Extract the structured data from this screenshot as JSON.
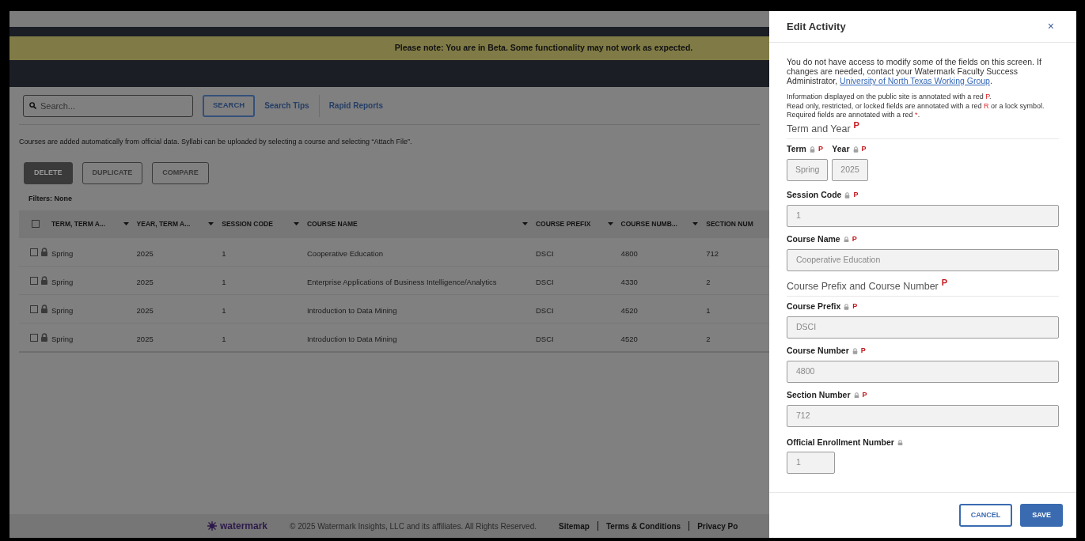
{
  "banner": "Please note: You are in Beta. Some functionality may not work as expected.",
  "search": {
    "placeholder": "Search...",
    "button": "SEARCH",
    "links": [
      "Search Tips",
      "Rapid Reports"
    ]
  },
  "notice": "Courses are added automatically from official data. Syllabi can be uploaded by selecting a course and selecting “Attach File”.",
  "actions": [
    {
      "label": "DELETE",
      "kind": "primary"
    },
    {
      "label": "DUPLICATE",
      "kind": "outline"
    },
    {
      "label": "COMPARE",
      "kind": "outline"
    }
  ],
  "filters": "Filters: None",
  "table": {
    "header_checked": false,
    "columns": [
      {
        "label": "TERM, TERM A...",
        "sortable": true
      },
      {
        "label": "YEAR, TERM A...",
        "sortable": true
      },
      {
        "label": "SESSION CODE",
        "sortable": true
      },
      {
        "label": "COURSE NAME",
        "sortable": true
      },
      {
        "label": "COURSE PREFIX",
        "sortable": true
      },
      {
        "label": "COURSE NUMB...",
        "sortable": true
      },
      {
        "label": "SECTION NUM",
        "sortable": false
      }
    ],
    "rows": [
      {
        "checked": false,
        "locked": true,
        "cells": [
          "Spring",
          "2025",
          "1",
          "Cooperative Education",
          "DSCI",
          "4800",
          "712"
        ]
      },
      {
        "checked": false,
        "locked": true,
        "cells": [
          "Spring",
          "2025",
          "1",
          "Enterprise Applications of Business Intelligence/Analytics",
          "DSCI",
          "4330",
          "2"
        ]
      },
      {
        "checked": false,
        "locked": true,
        "cells": [
          "Spring",
          "2025",
          "1",
          "Introduction to Data Mining",
          "DSCI",
          "4520",
          "1"
        ]
      },
      {
        "checked": false,
        "locked": true,
        "cells": [
          "Spring",
          "2025",
          "1",
          "Introduction to Data Mining",
          "DSCI",
          "4520",
          "2"
        ]
      }
    ]
  },
  "footer": {
    "logo": "watermark",
    "copyright": "© 2025 Watermark Insights, LLC and its affiliates. All Rights Reserved.",
    "links": [
      "Sitemap",
      "Terms & Conditions",
      "Privacy Po"
    ]
  },
  "drawer": {
    "title": "Edit Activity",
    "close": "×",
    "intro": {
      "text": "You do not have access to modify some of the fields on this screen. If changes are needed, contact your Watermark Faculty Success Administrator, ",
      "link": "University of North Texas Working Group",
      "end": "."
    },
    "notes": [
      {
        "text": "Information displayed on the public site is annotated with a red ",
        "mark": "P",
        "end": "."
      },
      {
        "text": "Read only, restricted, or locked fields are annotated with a red ",
        "mark": "R",
        "end": " or a lock symbol."
      },
      {
        "text": "Required fields are annotated with a red ",
        "mark": "*",
        "end": "."
      }
    ],
    "sections": [
      {
        "kind": "heading",
        "label": "Term and Year",
        "mark": "P"
      },
      {
        "kind": "pair",
        "fields": [
          {
            "label": "Term",
            "locked": true,
            "mark": "P",
            "value": "Spring"
          },
          {
            "label": "Year",
            "locked": true,
            "mark": "P",
            "value": "2025"
          }
        ]
      },
      {
        "kind": "field",
        "label": "Session Code",
        "locked": true,
        "mark": "P",
        "value": "1"
      },
      {
        "kind": "field",
        "label": "Course Name",
        "locked": true,
        "mark": "P",
        "value": "Cooperative Education"
      },
      {
        "kind": "heading",
        "label": "Course Prefix and Course Number",
        "mark": "P"
      },
      {
        "kind": "field",
        "label": "Course Prefix",
        "locked": true,
        "mark": "P",
        "value": "DSCI"
      },
      {
        "kind": "field",
        "label": "Course Number",
        "locked": true,
        "mark": "P",
        "value": "4800"
      },
      {
        "kind": "field",
        "label": "Section Number",
        "locked": true,
        "mark": "P",
        "value": "712"
      },
      {
        "kind": "short",
        "label": "Official Enrollment Number",
        "locked": true,
        "value": "1"
      }
    ],
    "buttons": [
      {
        "label": "CANCEL",
        "kind": "outline"
      },
      {
        "label": "SAVE",
        "kind": "primary"
      }
    ]
  }
}
